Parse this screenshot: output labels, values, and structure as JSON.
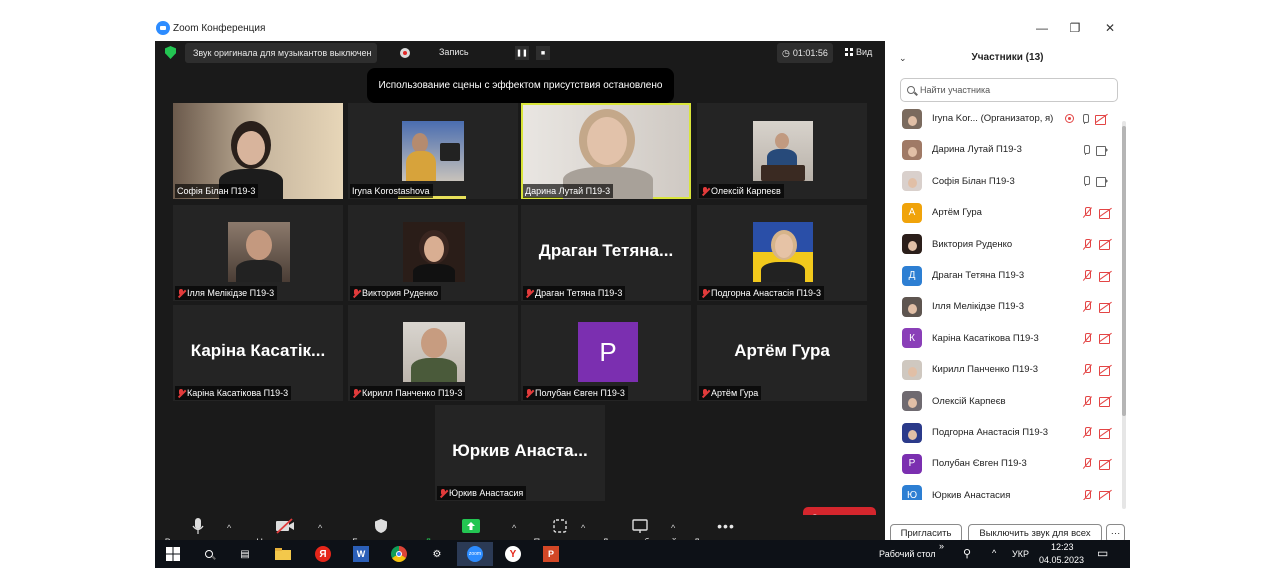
{
  "window": {
    "title": "Zoom Конференция"
  },
  "meeting": {
    "audio_notice": "Звук оригинала для музыкантов выключен",
    "recording_label": "Запись",
    "timer": "01:01:56",
    "view_label": "Вид",
    "toast": "Использование сцены с эффектом присутствия остановлено",
    "tiles": [
      {
        "name": "Софія Білан П19-3",
        "muted": false,
        "big": ""
      },
      {
        "name": "Iryna Korostashova",
        "muted": false,
        "big": ""
      },
      {
        "name": "Дарина Лутай П19-3",
        "muted": false,
        "big": ""
      },
      {
        "name": "Олексій Карпеєв",
        "muted": true,
        "big": ""
      },
      {
        "name": "Ілля Мелікідзе П19-3",
        "muted": true,
        "big": ""
      },
      {
        "name": "Виктория Руденко",
        "muted": true,
        "big": ""
      },
      {
        "name": "Драган Тетяна П19-3",
        "muted": true,
        "big": "Драган Тетяна..."
      },
      {
        "name": "Подгорна Анастасія П19-3",
        "muted": true,
        "big": ""
      },
      {
        "name": "Каріна Касатікова П19-3",
        "muted": true,
        "big": "Каріна Касатік..."
      },
      {
        "name": "Кирилл Панченко П19-3",
        "muted": true,
        "big": ""
      },
      {
        "name": "Полубан Євген П19-3",
        "muted": true,
        "big": "",
        "initial": "P"
      },
      {
        "name": "Артём Гура",
        "muted": true,
        "big": "Артём Гура"
      },
      {
        "name": "Юркив Анастасия",
        "muted": true,
        "big": "Юркив Анаста..."
      }
    ]
  },
  "toolbar": {
    "mute": "Выключить звук",
    "video": "Начать видео",
    "security": "Безопасность",
    "share": "Демонстрация экрана",
    "apps": "Приложения",
    "whiteboards": "Доски сообщений",
    "more": "Дополнительно",
    "end": "Завершение"
  },
  "participants": {
    "header": "Участники (13)",
    "search_placeholder": "Найти участника",
    "list": [
      {
        "name": "Iryna Kor... (Организатор, я)",
        "avatar": "photo",
        "color": "#7a6a5e",
        "state": "host"
      },
      {
        "name": "Дарина Лутай П19-3",
        "avatar": "photo",
        "color": "#a07a66",
        "state": "on"
      },
      {
        "name": "Софія Білан П19-3",
        "avatar": "photo",
        "color": "#d9d0cc",
        "state": "on"
      },
      {
        "name": "Артём Гура",
        "avatar": "А",
        "color": "#f0a30a",
        "state": "off"
      },
      {
        "name": "Виктория Руденко",
        "avatar": "photo",
        "color": "#2b1e1a",
        "state": "off"
      },
      {
        "name": "Драган Тетяна П19-3",
        "avatar": "Д",
        "color": "#2d7fd3",
        "state": "off"
      },
      {
        "name": "Ілля Мелікідзе П19-3",
        "avatar": "photo",
        "color": "#5e5550",
        "state": "off"
      },
      {
        "name": "Каріна Касатікова П19-3",
        "avatar": "К",
        "color": "#8a3fb8",
        "state": "off"
      },
      {
        "name": "Кирилл Панченко П19-3",
        "avatar": "photo",
        "color": "#cfc8c0",
        "state": "off"
      },
      {
        "name": "Олексій Карпеєв",
        "avatar": "photo",
        "color": "#6f6a70",
        "state": "off"
      },
      {
        "name": "Подгорна Анастасія П19-3",
        "avatar": "photo",
        "color": "#2b3a8a",
        "state": "off"
      },
      {
        "name": "Полубан Євген П19-3",
        "avatar": "P",
        "color": "#7b2fb0",
        "state": "off"
      },
      {
        "name": "Юркив Анастасия",
        "avatar": "Ю",
        "color": "#2d7fd3",
        "state": "off"
      }
    ],
    "invite": "Пригласить",
    "mute_all": "Выключить звук для всех",
    "more": "···"
  },
  "taskbar": {
    "desktop_label": "Рабочий стол",
    "lang": "УКР",
    "time": "12:23",
    "date": "04.05.2023"
  }
}
